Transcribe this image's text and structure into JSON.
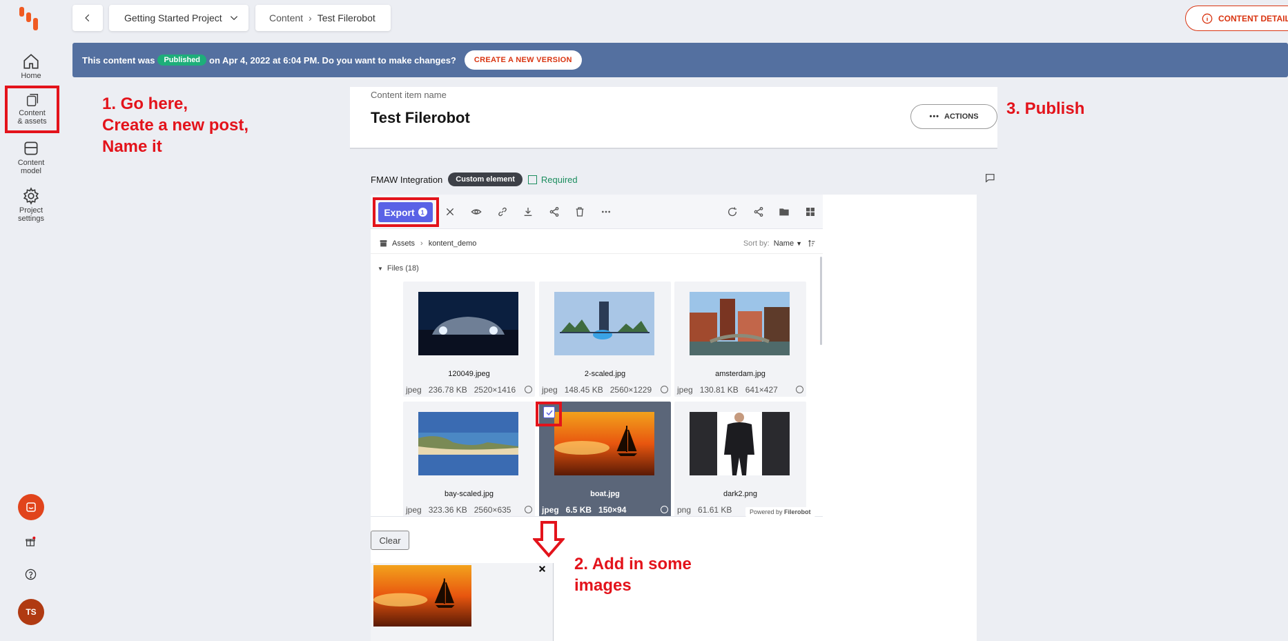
{
  "sidebar": {
    "items": [
      {
        "label_1": "Home",
        "label_2": ""
      },
      {
        "label_1": "Content",
        "label_2": "& assets"
      },
      {
        "label_1": "Content",
        "label_2": "model"
      },
      {
        "label_1": "Project",
        "label_2": "settings"
      }
    ],
    "avatar_initials": "TS"
  },
  "topbar": {
    "project": "Getting Started Project",
    "breadcrumb_root": "Content",
    "breadcrumb_current": "Test Filerobot",
    "details_button": "CONTENT DETAILS"
  },
  "banner": {
    "text_before": "This content was",
    "status": "Published",
    "text_after": "on Apr 4, 2022 at 6:04 PM. Do you want to make changes?",
    "action": "CREATE A NEW VERSION"
  },
  "editor": {
    "name_label": "Content item name",
    "name_value": "Test Filerobot",
    "actions_label": "ACTIONS"
  },
  "element": {
    "label": "FMAW Integration",
    "chip": "Custom element",
    "required": "Required"
  },
  "filerobot": {
    "export_label": "Export",
    "export_count": "1",
    "path_root": "Assets",
    "path_folder": "kontent_demo",
    "sort_label": "Sort by:",
    "sort_value": "Name",
    "files_header": "Files (18)",
    "powered_prefix": "Powered by",
    "powered_brand": "Filerobot",
    "files": [
      {
        "name": "120049.jpeg",
        "type": "jpeg",
        "size": "236.78 KB",
        "dims": "2520×1416"
      },
      {
        "name": "2-scaled.jpg",
        "type": "jpeg",
        "size": "148.45 KB",
        "dims": "2560×1229"
      },
      {
        "name": "amsterdam.jpg",
        "type": "jpeg",
        "size": "130.81 KB",
        "dims": "641×427"
      },
      {
        "name": "bay-scaled.jpg",
        "type": "jpeg",
        "size": "323.36 KB",
        "dims": "2560×635"
      },
      {
        "name": "boat.jpg",
        "type": "jpeg",
        "size": "6.5 KB",
        "dims": "150×94"
      },
      {
        "name": "dark2.png",
        "type": "png",
        "size": "61.61 KB",
        "dims": ""
      }
    ],
    "clear_label": "Clear"
  },
  "annotations": {
    "step1_line1": "1. Go here,",
    "step1_line2": "Create a new post,",
    "step1_line3": "Name it",
    "step2_line1": "2. Add in some",
    "step2_line2": "images",
    "step3": "3. Publish"
  },
  "colors": {
    "accent": "#d93410",
    "banner": "#5470a0",
    "published": "#1eae7a",
    "export": "#5a62e6",
    "annotation": "#e3131b"
  }
}
